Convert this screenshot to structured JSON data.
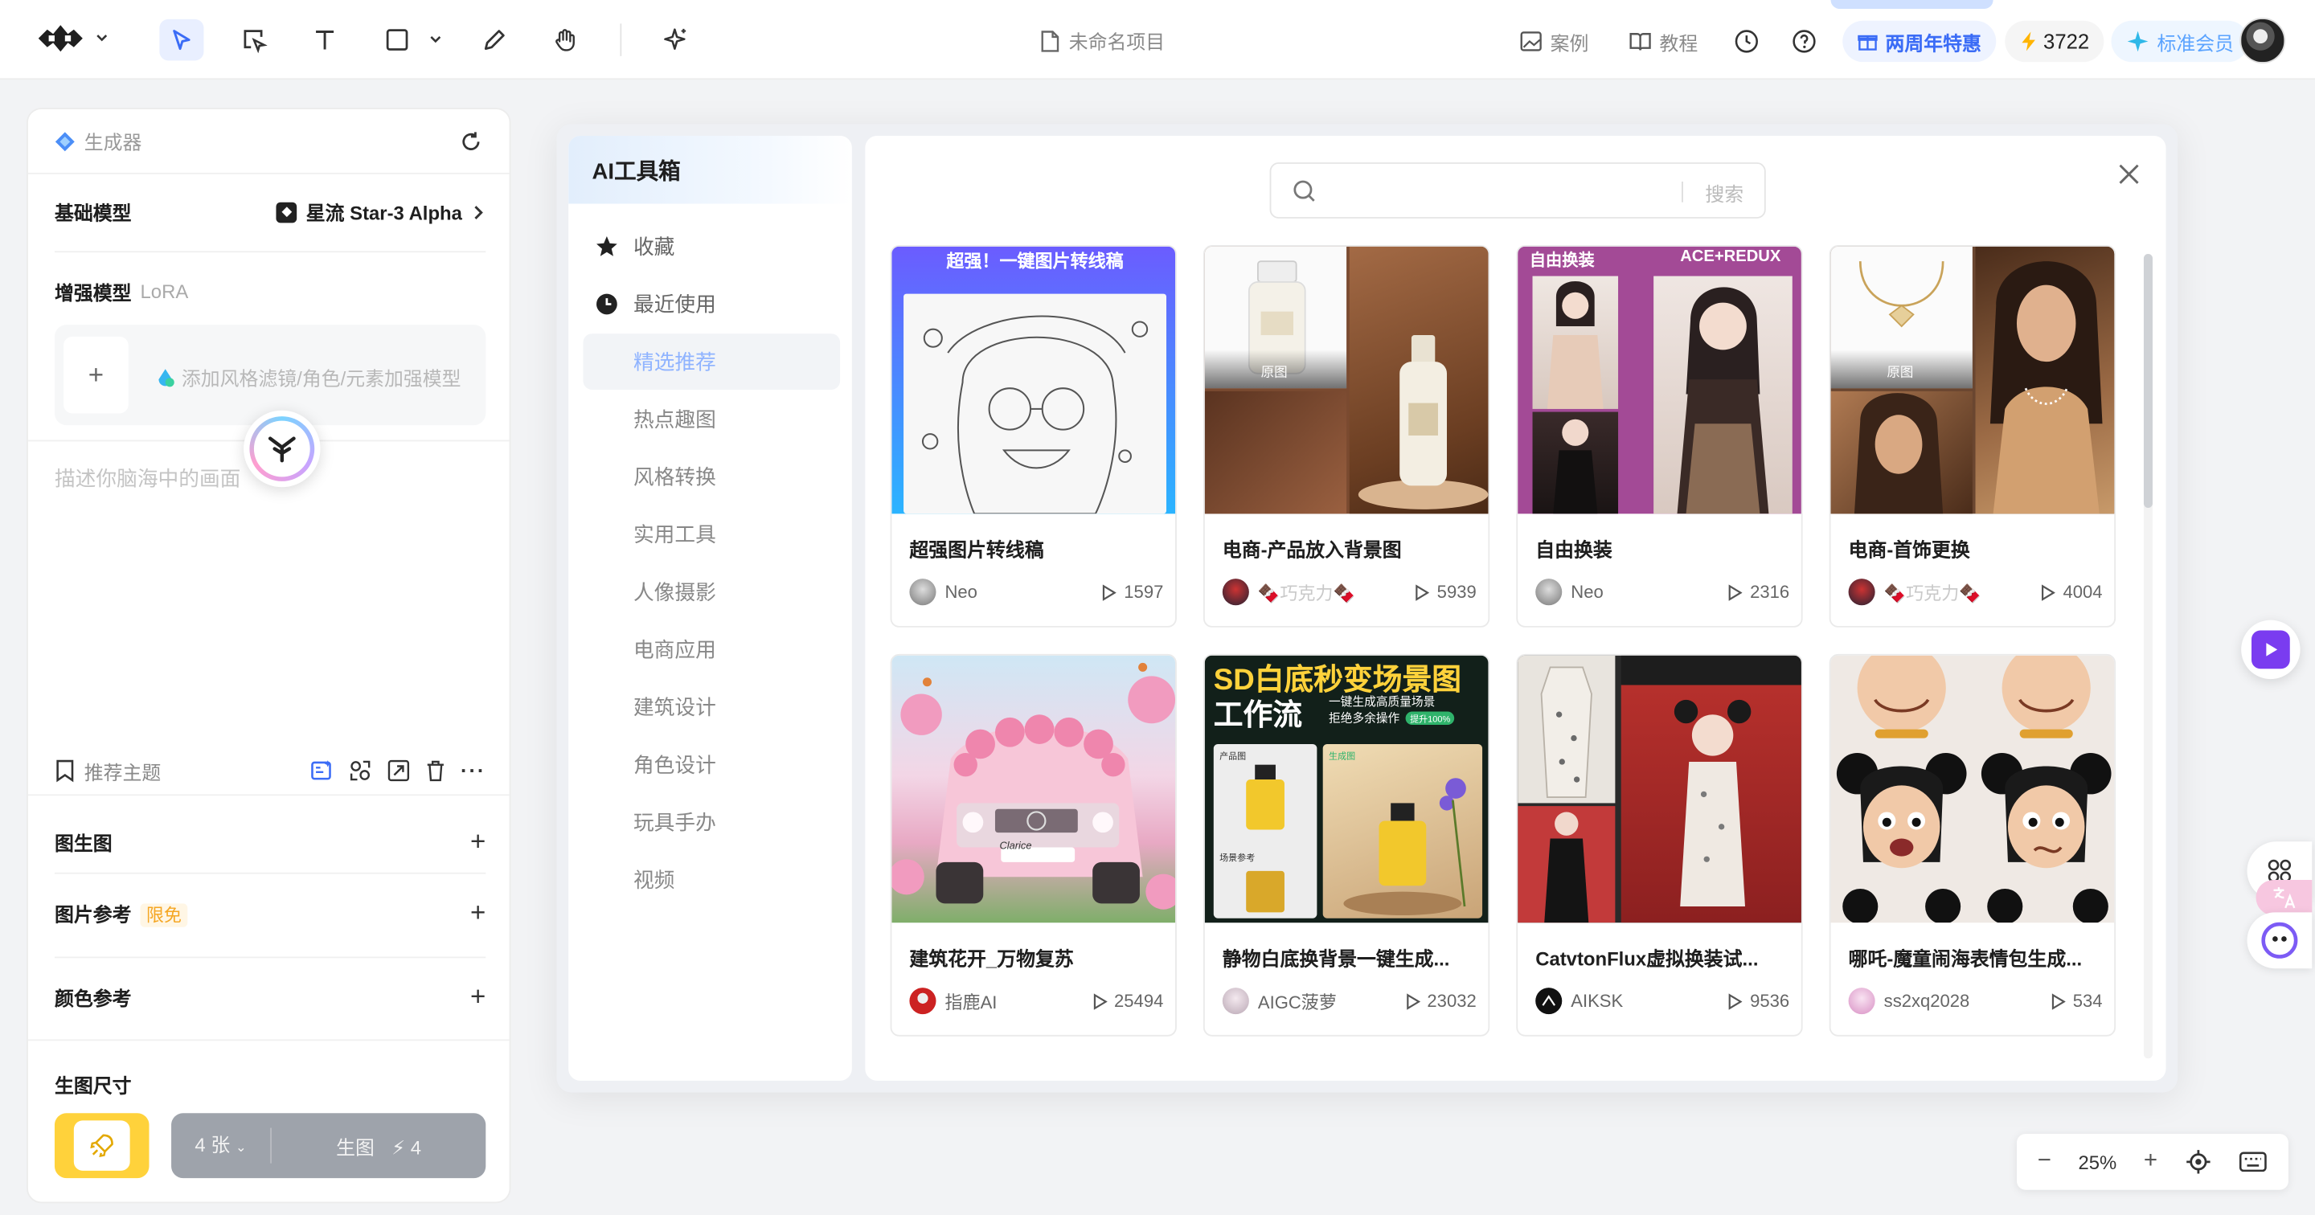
{
  "topbar": {
    "doc_title": "未命名项目",
    "cases_label": "案例",
    "tutorial_label": "教程",
    "anniversary_label": "两周年特惠",
    "credits": "3722",
    "member_label": "标准会员"
  },
  "left_panel": {
    "header_label": "生成器",
    "base_model_label": "基础模型",
    "base_model_value": "星流 Star-3 Alpha",
    "enhance_label": "增强模型",
    "enhance_sub": "LoRA",
    "lora_placeholder": "添加风格滤镜/角色/元素加强模型",
    "prompt_placeholder": "描述你脑海中的画面",
    "theme_label": "推荐主题",
    "img2img_label": "图生图",
    "img_ref_label": "图片参考",
    "img_ref_tag": "限免",
    "color_ref_label": "颜色参考",
    "size_label": "生图尺寸",
    "count_label": "4 张",
    "generate_label": "生图",
    "generate_cost": "4"
  },
  "toolbox": {
    "title": "AI工具箱",
    "search_placeholder": "搜索",
    "nav": [
      {
        "label": "收藏"
      },
      {
        "label": "最近使用"
      },
      {
        "label": "精选推荐"
      },
      {
        "label": "热点趣图"
      },
      {
        "label": "风格转换"
      },
      {
        "label": "实用工具"
      },
      {
        "label": "人像摄影"
      },
      {
        "label": "电商应用"
      },
      {
        "label": "建筑设计"
      },
      {
        "label": "角色设计"
      },
      {
        "label": "玩具手办"
      },
      {
        "label": "视频"
      }
    ],
    "cards": [
      {
        "title": "超强图片转线稿",
        "author": "Neo",
        "plays": "1597",
        "banner": "超强！一键图片转线稿"
      },
      {
        "title": "电商-产品放入背景图",
        "author": "🍫巧克力🍫",
        "plays": "5939",
        "tag": "原图"
      },
      {
        "title": "自由换装",
        "author": "Neo",
        "plays": "2316",
        "banner_left": "自由换装",
        "banner_right": "ACE+REDUX"
      },
      {
        "title": "电商-首饰更换",
        "author": "🍫巧克力🍫",
        "plays": "4004",
        "tag": "原图"
      },
      {
        "title": "建筑花开_万物复苏",
        "author": "指鹿AI",
        "plays": "25494",
        "plate": "Clarice"
      },
      {
        "title": "静物白底换背景一键生成...",
        "author": "AIGC菠萝",
        "plays": "23032",
        "headline_1": "SD白底秒变场景图",
        "headline_2": "工作流",
        "headline_sub_1": "一键生成高质量场景",
        "headline_sub_2": "拒绝多余操作",
        "badge": "提升100%",
        "chip_1": "产品图",
        "chip_2": "生成图",
        "chip_3": "场景参考"
      },
      {
        "title": "CatvtonFlux虚拟换装试...",
        "author": "AIKSK",
        "plays": "9536"
      },
      {
        "title": "哪吒-魔童闹海表情包生成...",
        "author": "ss2xq2028",
        "plays": "534"
      }
    ]
  },
  "zoom": {
    "value": "25%"
  },
  "colors": {
    "accent": "#3b6cf6",
    "generate_yellow": "#ffd23b",
    "sidebar_active_text": "#8fb3ff"
  }
}
